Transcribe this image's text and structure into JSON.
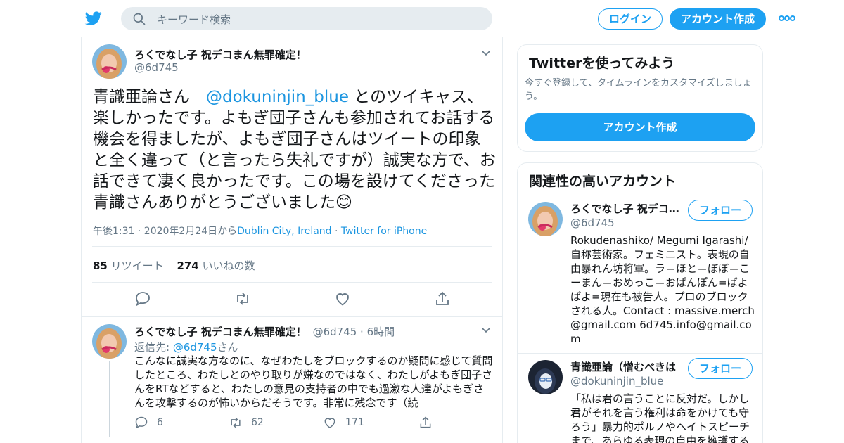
{
  "header": {
    "search_placeholder": "キーワード検索",
    "login_label": "ログイン",
    "signup_label": "アカウント作成",
    "brand_color": "#1da1f2"
  },
  "tweet": {
    "author_name": "ろくでなし子 祝デコまん無罪確定！",
    "author_handle": "@6d745",
    "text_before": "青識亜論さん　",
    "text_mention": "@dokuninjin_blue",
    "text_after": " とのツイキャス、楽しかったです。よもぎ団子さんも参加されてお話する機会を得ましたが、よもぎ団子さんはツイートの印象と全く違って（と言ったら失礼ですが）誠実な方で、お話できて凄く良かったです。この場を設けてくださった青識さんありがとうございました😊",
    "timestamp": "午後1:31 · 2020年2月24日から",
    "location": "Dublin City, Ireland",
    "sep": " · ",
    "client": "Twitter for iPhone",
    "retweet_count": "85",
    "retweet_label": " リツイート",
    "like_count": "274",
    "like_label": " いいねの数"
  },
  "reply": {
    "author_name": "ろくでなし子 祝デコまん無罪確定！",
    "author_handle": "@6d745",
    "time_sep": " · ",
    "time": "6時間",
    "replying_to_label": "返信先: ",
    "replying_to_handle": "@6d745",
    "replying_to_suffix": "さん",
    "text": "こんなに誠実な方なのに、なぜわたしをブロックするのか疑問に感じて質問したところ、わたしとのやり取りが嫌なのではなく、わたしがよもぎ団子さんをRTなどすると、わたしの意見の支持者の中でも過激な人達がよもぎさんを攻撃するのが怖いからだそうです。非常に残念です（続",
    "reply_count": "6",
    "retweet_count": "62",
    "like_count": "171"
  },
  "sidebar": {
    "try_title": "Twitterを使ってみよう",
    "try_sub": "今すぐ登録して、タイムラインをカスタマイズしましょう。",
    "try_button": "アカウント作成",
    "related_title": "関連性の高いアカウント",
    "accounts": [
      {
        "name": "ろくでなし子 祝デコまん無罪確定！",
        "handle": "@6d745",
        "follow_label": "フォロー",
        "bio": "Rokudenashiko/ Megumi Igarashi/ 自称芸術家。フェミニスト。表現の自由暴れん坊将軍。ラ＝ほと＝ぼぼ＝こーまん＝おめっこ＝おぱんぽん=ぱよぱよ=現在も被告人。プロのブロックされる人。Contact : massive.merch@gmail.com 6d745.info@gmail.com"
      },
      {
        "name": "青識亜論（憎むべきは",
        "handle": "@dokuninjin_blue",
        "follow_label": "フォロー",
        "bio": "「私は君の言うことに反対だ。しかし君がそれを言う権利は命をかけても守ろう」暴力的ポルノやヘイトスピーチまで、あらゆる表現の自由を擁護する"
      }
    ]
  }
}
